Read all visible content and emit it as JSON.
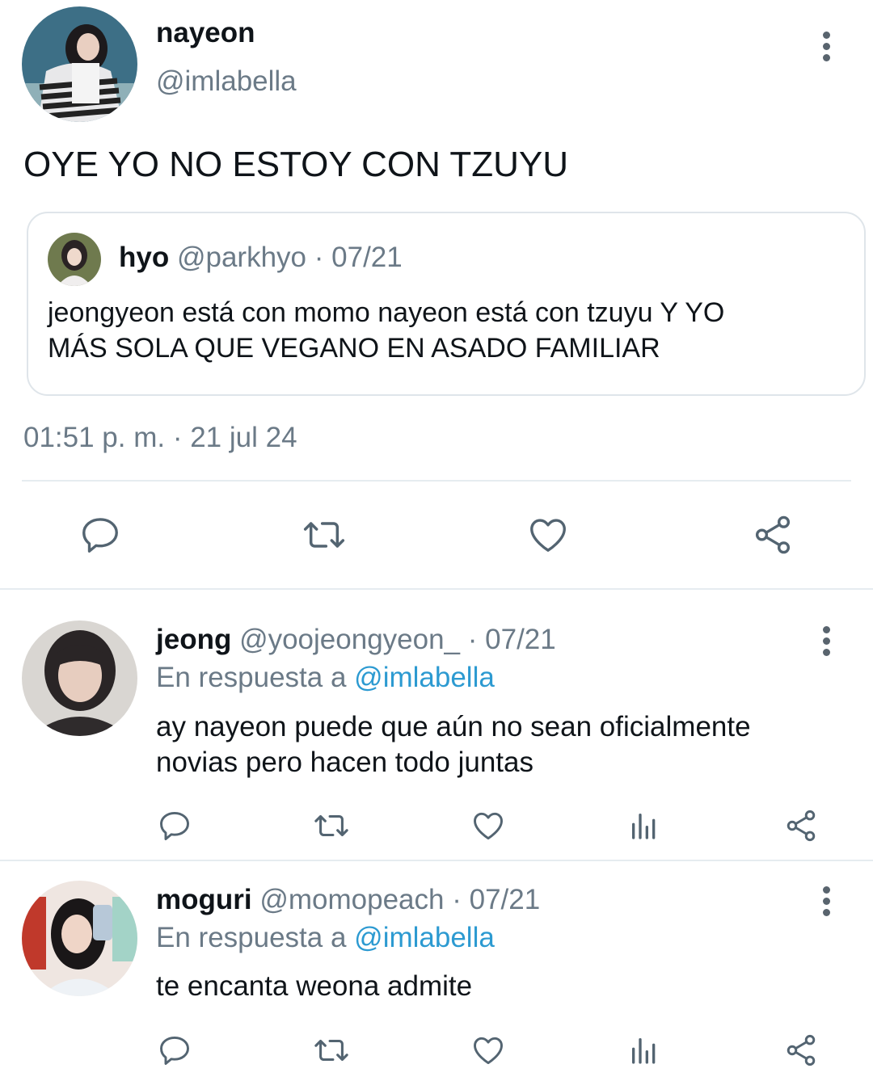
{
  "main_tweet": {
    "author": {
      "name": "nayeon",
      "handle": "@imlabella"
    },
    "text": "OYE YO NO ESTOY CON TZUYU",
    "quoted": {
      "name": "hyo",
      "handle": "@parkhyo",
      "separator": "·",
      "date": "07/21",
      "text_line1": "jeongyeon está con momo nayeon está con tzuyu Y YO",
      "text_line2": "MÁS SOLA QUE VEGANO EN ASADO FAMILIAR"
    },
    "timestamp": "01:51 p. m. · 21 jul 24",
    "actions": [
      "reply-icon",
      "retweet-icon",
      "heart-icon",
      "share-icon"
    ]
  },
  "replies": [
    {
      "name": "jeong",
      "handle": "@yoojeongyeon_",
      "separator": "·",
      "date": "07/21",
      "in_reply_prefix": "En respuesta a",
      "in_reply_handle": "@imlabella",
      "text_line1": "ay nayeon puede que aún no sean oficialmente",
      "text_line2": "novias pero hacen todo juntas"
    },
    {
      "name": "moguri",
      "handle": "@momopeach",
      "separator": "·",
      "date": "07/21",
      "in_reply_prefix": "En respuesta a",
      "in_reply_handle": "@imlabella",
      "text_line1": "te encanta weona admite"
    }
  ],
  "colors": {
    "text": "#0f1419",
    "muted": "#6b7a87",
    "link": "#2c9ad1",
    "divider": "#e6ecf0",
    "icon": "#536471"
  }
}
